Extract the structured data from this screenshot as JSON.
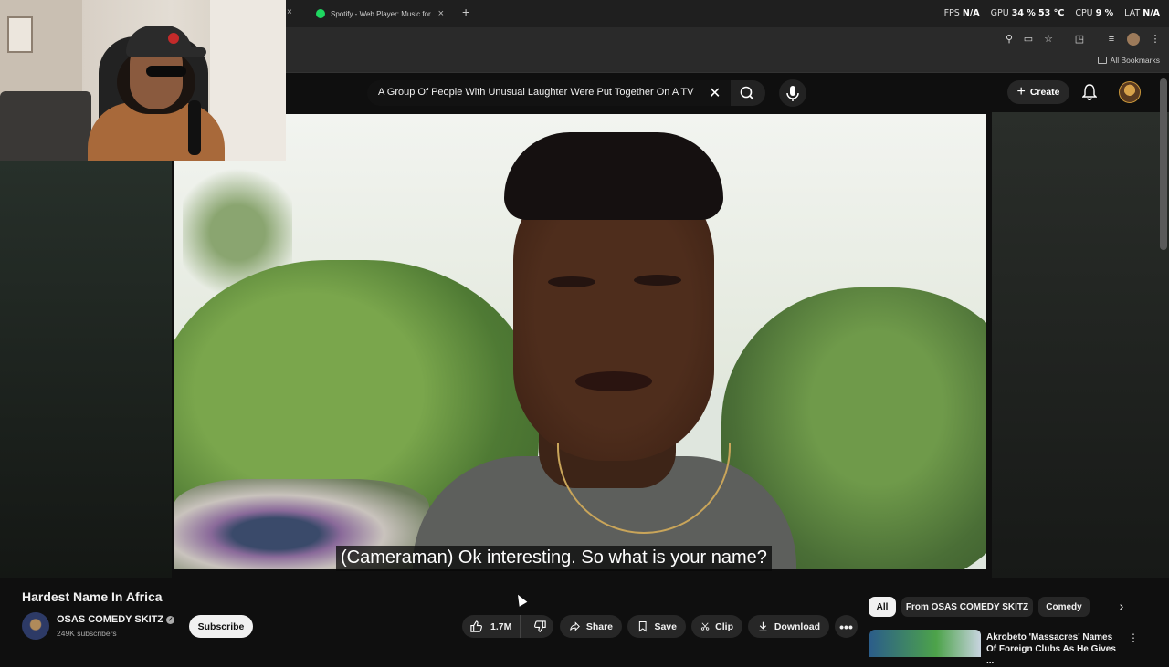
{
  "browser": {
    "tabs": [
      {
        "title": "Spotify - Web Player: Music for",
        "icon": "spotify-icon"
      }
    ],
    "bookmarks_label": "All Bookmarks"
  },
  "overlay_stats": {
    "fps_label": "FPS",
    "fps_value": "N/A",
    "gpu_label": "GPU",
    "gpu_value": "34 % 53 °C",
    "cpu_label": "CPU",
    "cpu_value": "9 %",
    "lat_label": "LAT",
    "lat_value": "N/A"
  },
  "header": {
    "search_query": "A Group Of People With Unusual Laughter Were Put Together On A TV",
    "create_label": "Create"
  },
  "video": {
    "subtitle": "(Cameraman) Ok interesting. So what is your name?",
    "title": "Hardest Name In Africa"
  },
  "channel": {
    "name": "OSAS COMEDY SKITZ",
    "subscribers": "249K subscribers",
    "subscribe_label": "Subscribe"
  },
  "actions": {
    "like_count": "1.7M",
    "share_label": "Share",
    "save_label": "Save",
    "clip_label": "Clip",
    "download_label": "Download"
  },
  "chips": {
    "all": "All",
    "from_channel": "From OSAS COMEDY SKITZ",
    "comedy": "Comedy"
  },
  "recommendation": {
    "title": "Akrobeto 'Massacres' Names Of Foreign Clubs As He Gives ..."
  },
  "colors": {
    "background": "#0f0f0f",
    "pill": "#272727",
    "spotify_green": "#1ed760"
  }
}
